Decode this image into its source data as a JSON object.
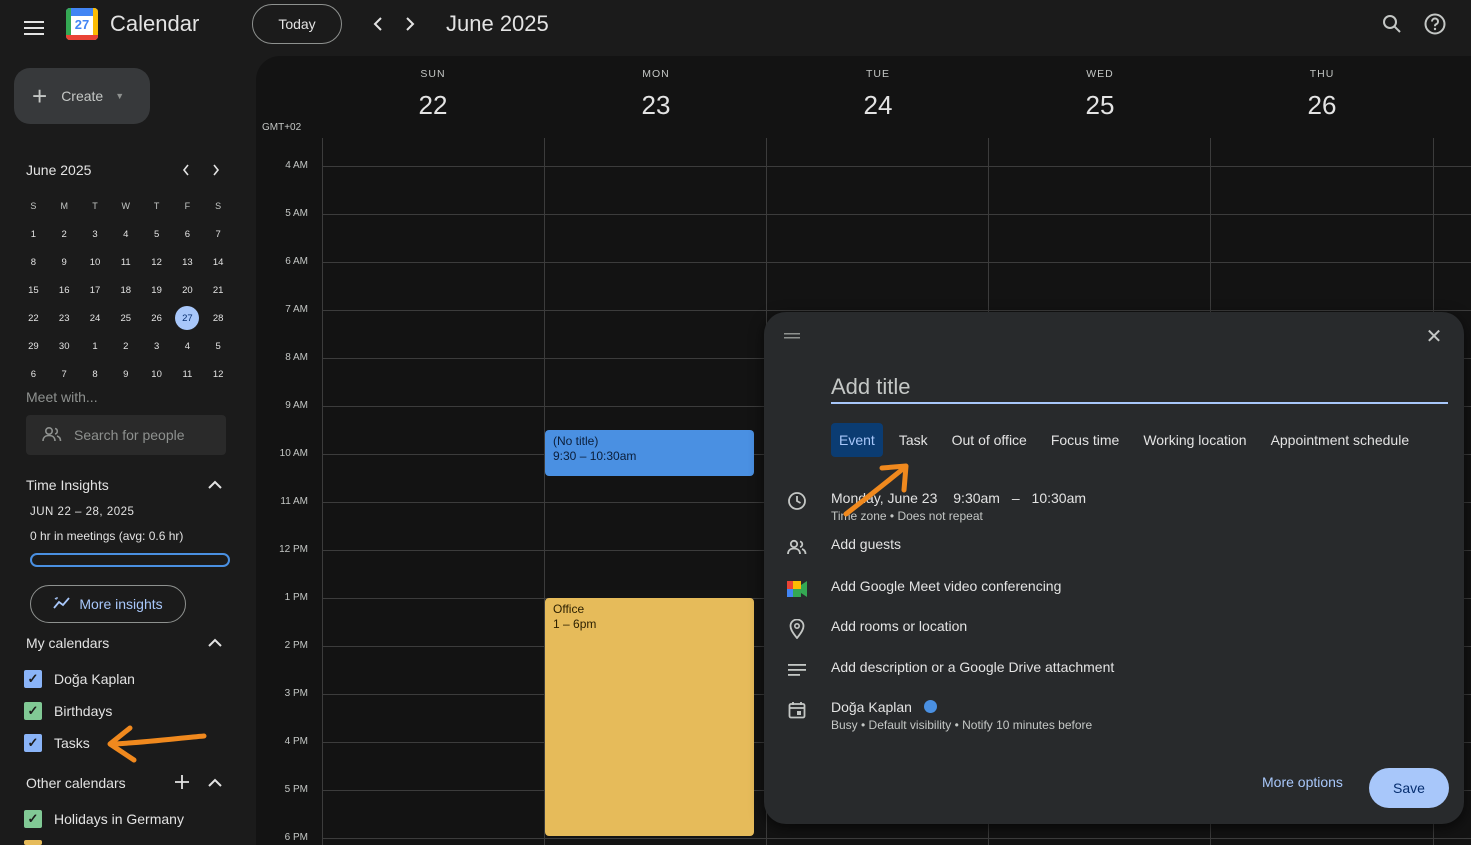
{
  "header": {
    "app_title": "Calendar",
    "logo_day": "27",
    "today_label": "Today",
    "month_title": "June 2025"
  },
  "sidebar": {
    "create_label": "Create",
    "mini_calendar": {
      "title": "June 2025",
      "weekdays": [
        "S",
        "M",
        "T",
        "W",
        "T",
        "F",
        "S"
      ],
      "weeks": [
        [
          "1",
          "2",
          "3",
          "4",
          "5",
          "6",
          "7"
        ],
        [
          "8",
          "9",
          "10",
          "11",
          "12",
          "13",
          "14"
        ],
        [
          "15",
          "16",
          "17",
          "18",
          "19",
          "20",
          "21"
        ],
        [
          "22",
          "23",
          "24",
          "25",
          "26",
          "27",
          "28"
        ],
        [
          "29",
          "30",
          "1",
          "2",
          "3",
          "4",
          "5"
        ],
        [
          "6",
          "7",
          "8",
          "9",
          "10",
          "11",
          "12"
        ]
      ],
      "selected": "27"
    },
    "meet_with": "Meet with...",
    "search_people_placeholder": "Search for people",
    "time_insights": {
      "heading": "Time Insights",
      "range": "JUN 22 – 28, 2025",
      "summary": "0 hr in meetings (avg: 0.6 hr)",
      "more_label": "More insights"
    },
    "my_calendars": {
      "heading": "My calendars",
      "items": [
        {
          "label": "Doğa Kaplan",
          "color": "#8ab4f8"
        },
        {
          "label": "Birthdays",
          "color": "#81c995"
        },
        {
          "label": "Tasks",
          "color": "#8ab4f8"
        }
      ]
    },
    "other_calendars": {
      "heading": "Other calendars",
      "items": [
        {
          "label": "Holidays in Germany",
          "color": "#81c995"
        }
      ]
    }
  },
  "week_view": {
    "timezone": "GMT+02",
    "days": [
      {
        "dow": "SUN",
        "date": "22"
      },
      {
        "dow": "MON",
        "date": "23"
      },
      {
        "dow": "TUE",
        "date": "24"
      },
      {
        "dow": "WED",
        "date": "25"
      },
      {
        "dow": "THU",
        "date": "26"
      }
    ],
    "hours": [
      "4 AM",
      "5 AM",
      "6 AM",
      "7 AM",
      "8 AM",
      "9 AM",
      "10 AM",
      "11 AM",
      "12 PM",
      "1 PM",
      "2 PM",
      "3 PM",
      "4 PM",
      "5 PM",
      "6 PM"
    ],
    "events": [
      {
        "title": "(No title)",
        "time": "9:30 – 10:30am",
        "color": "#4a90e2"
      },
      {
        "title": "Office",
        "time": "1 – 6pm",
        "color": "#e6bb5a"
      }
    ]
  },
  "event_dialog": {
    "title_placeholder": "Add title",
    "tabs": [
      "Event",
      "Task",
      "Out of office",
      "Focus time",
      "Working location",
      "Appointment schedule"
    ],
    "active_tab": "Event",
    "date_label": "Monday, June 23",
    "start_time": "9:30am",
    "dash": "–",
    "end_time": "10:30am",
    "repeat_info": "Time zone • Does not repeat",
    "add_guests": "Add guests",
    "add_meet": "Add Google Meet video conferencing",
    "add_location": "Add rooms or location",
    "add_description": "Add description or a Google Drive attachment",
    "owner": "Doğa Kaplan",
    "owner_details": "Busy • Default visibility • Notify 10 minutes before",
    "more_options": "More options",
    "save_label": "Save"
  },
  "colors": {
    "accent": "#a8c7fa",
    "annotation_arrow": "#f0891e"
  }
}
